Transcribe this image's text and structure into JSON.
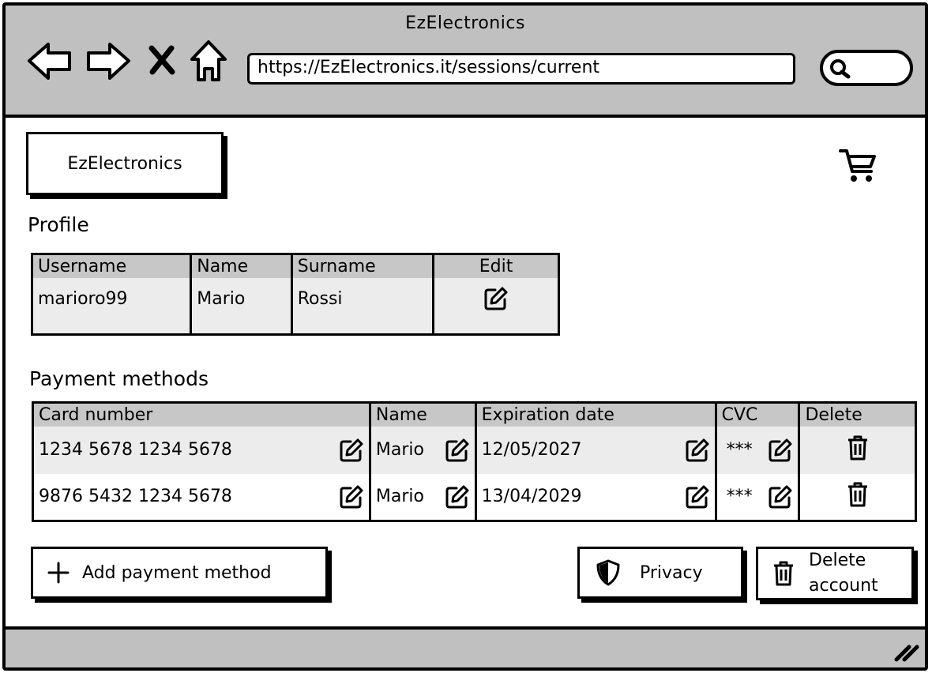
{
  "browser": {
    "title": "EzElectronics",
    "url": "https://EzElectronics.it/sessions/current",
    "nav_icons": [
      "back-arrow-icon",
      "forward-arrow-icon",
      "stop-x-icon",
      "home-icon"
    ],
    "search_icon": "search-icon"
  },
  "header": {
    "logo_text": "EzElectronics",
    "cart_icon": "cart-icon"
  },
  "profile": {
    "section_title": "Profile",
    "columns": [
      "Username",
      "Name",
      "Surname",
      "Edit"
    ],
    "row": {
      "username": "marioro99",
      "name": "Mario",
      "surname": "Rossi"
    }
  },
  "payment": {
    "section_title": "Payment methods",
    "columns": [
      "Card number",
      "Name",
      "Expiration date",
      "CVC",
      "Delete"
    ],
    "rows": [
      {
        "card": "1234 5678 1234 5678",
        "name": "Mario",
        "expiration": "12/05/2027",
        "cvc": "***"
      },
      {
        "card": "9876 5432 1234 5678",
        "name": "Mario",
        "expiration": "13/04/2029",
        "cvc": "***"
      }
    ]
  },
  "actions": {
    "add_payment": "Add payment method",
    "privacy": "Privacy",
    "delete_account_line1": "Delete",
    "delete_account_line2": "account"
  },
  "colors": {
    "chrome": "#c0c0c0",
    "header_row": "#c7c7c7",
    "row_fill": "#ececec"
  }
}
